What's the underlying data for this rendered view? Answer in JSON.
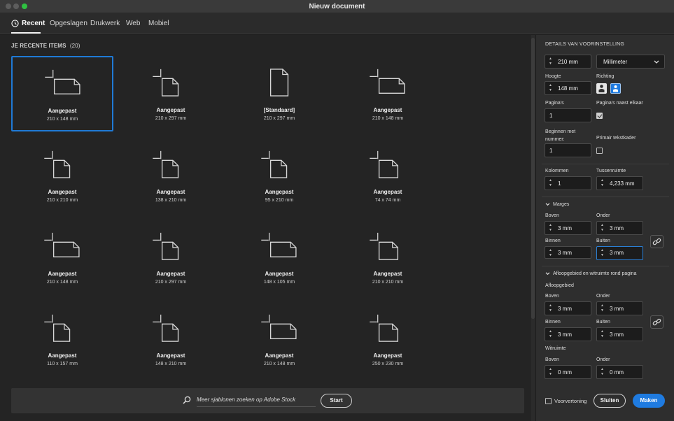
{
  "window": {
    "title": "Nieuw document"
  },
  "tabs": [
    {
      "label": "Recent"
    },
    {
      "label": "Opgeslagen"
    },
    {
      "label": "Drukwerk"
    },
    {
      "label": "Web"
    },
    {
      "label": "Mobiel"
    }
  ],
  "recent": {
    "heading": "JE RECENTE ITEMS",
    "count": "(20)",
    "items": [
      {
        "name": "Aangepast",
        "size": "210 x 148 mm",
        "icon": "landscape-doc-icon"
      },
      {
        "name": "Aangepast",
        "size": "210 x 297 mm",
        "icon": "portrait-doc-icon"
      },
      {
        "name": "[Standaard]",
        "size": "210 x 297 mm",
        "icon": "standard-doc-icon"
      },
      {
        "name": "Aangepast",
        "size": "210 x 148 mm",
        "icon": "landscape-doc-icon"
      },
      {
        "name": "Aangepast",
        "size": "210 x 210 mm",
        "icon": "portrait-doc-icon"
      },
      {
        "name": "Aangepast",
        "size": "138 x 210 mm",
        "icon": "portrait-doc-icon"
      },
      {
        "name": "Aangepast",
        "size": "95 x 210 mm",
        "icon": "portrait-doc-icon"
      },
      {
        "name": "Aangepast",
        "size": "74 x 74 mm",
        "icon": "square-doc-icon"
      },
      {
        "name": "Aangepast",
        "size": "210 x 148 mm",
        "icon": "landscape-doc-icon"
      },
      {
        "name": "Aangepast",
        "size": "210 x 297 mm",
        "icon": "portrait-doc-icon"
      },
      {
        "name": "Aangepast",
        "size": "148 x 105 mm",
        "icon": "landscape-doc-icon"
      },
      {
        "name": "Aangepast",
        "size": "210 x 210 mm",
        "icon": "square-doc-icon"
      },
      {
        "name": "Aangepast",
        "size": "110 x 157 mm",
        "icon": "portrait-doc-icon"
      },
      {
        "name": "Aangepast",
        "size": "148 x 210 mm",
        "icon": "portrait-doc-icon"
      },
      {
        "name": "Aangepast",
        "size": "210 x 148 mm",
        "icon": "landscape-doc-icon"
      },
      {
        "name": "Aangepast",
        "size": "250 x 230 mm",
        "icon": "square-doc-icon"
      }
    ]
  },
  "search": {
    "placeholder": "Meer sjablonen zoeken op Adobe Stock",
    "button": "Start"
  },
  "details": {
    "heading": "DETAILS VAN VOORINSTELLING",
    "width": "210 mm",
    "unit": "Millimeter",
    "height_label": "Hoogte",
    "height": "148 mm",
    "orientation_label": "Richting",
    "pages_label": "Pagina's",
    "pages": "1",
    "facing_label": "Pagina's naast elkaar",
    "start_label": "Beginnen met nummer:",
    "start": "1",
    "primary_label": "Primair tekstkader",
    "columns_label": "Kolommen",
    "columns": "1",
    "gutter_label": "Tussenruimte",
    "gutter": "4,233 mm",
    "margins_label": "Marges",
    "top_label": "Boven",
    "bottom_label": "Onder",
    "inside_label": "Binnen",
    "outside_label": "Buiten",
    "margin_top": "3 mm",
    "margin_bottom": "3 mm",
    "margin_inside": "3 mm",
    "margin_outside": "3 mm",
    "bleed_section": "Afloopgebied en witruimte rond pagina",
    "bleed_label": "Afloopgebied",
    "bleed_top": "3 mm",
    "bleed_bottom": "3 mm",
    "bleed_inside": "3 mm",
    "bleed_outside": "3 mm",
    "slug_label": "Witruimte",
    "slug_top": "0 mm",
    "slug_bottom": "0 mm"
  },
  "footer": {
    "preview": "Voorvertoning",
    "close": "Sluiten",
    "make": "Maken"
  },
  "colors": {
    "accent": "#1f7be0",
    "selection": "#1f7ad6"
  }
}
